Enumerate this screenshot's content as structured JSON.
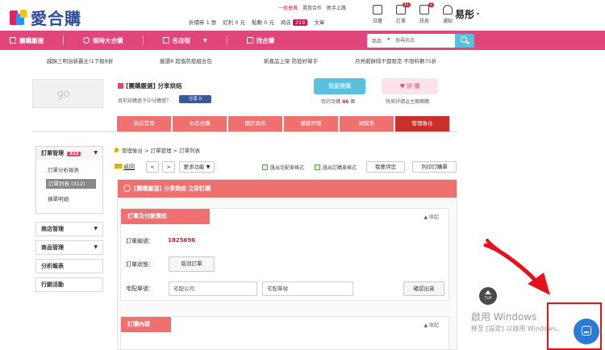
{
  "logo": {
    "text": "愛合購"
  },
  "member": {
    "level": "一般會員",
    "links": [
      "賣我合作",
      "新手上路"
    ]
  },
  "stats": {
    "discount": "折價券 1 張",
    "bonus": "紅利 0 元",
    "points": "點數 0 元",
    "store_label": "商店",
    "store_count": "219",
    "articles": "文章"
  },
  "icons": [
    {
      "name": "calendar-icon",
      "label": "日曆"
    },
    {
      "name": "order-icon",
      "label": "訂單",
      "badge": "31"
    },
    {
      "name": "message-icon",
      "label": "訊息",
      "badge": "2"
    },
    {
      "name": "bell-icon",
      "label": "通知"
    }
  ],
  "user_signature": "易彤",
  "nav": [
    "團購嚴選",
    "限時大合購",
    "名店街",
    "找合購"
  ],
  "search": {
    "category": "商品",
    "placeholder": "搜尋商品"
  },
  "promos": [
    "越酥三明治新霸主!1下殺8折",
    "嚴選8 超值防疫組合包",
    "新產品上架 防疫好幫手",
    "月亮蝦餅隔干都限定 不限料數75折"
  ],
  "store": {
    "logo_text": "go",
    "name": "[團購嚴選] 分享烘焙",
    "sub": "目前知購進于中分購撰？",
    "fb_label": "分享 0",
    "fav_label": "我要團購",
    "fav_sub_prefix": "我的合購",
    "fav_count": "46",
    "fav_sub_suffix": "團",
    "like_label": "♥ 評 價",
    "like_sub": "快來評價這主團團購"
  },
  "store_tabs": [
    "商店首頁",
    "本店合購",
    "關於商店",
    "顧客評價",
    "問與答",
    "管理後台"
  ],
  "sidebar": {
    "order_mgmt": "訂單管理",
    "order_count": "312",
    "items": [
      "訂單分析報表",
      "訂單列表 (312)",
      "揀單明細"
    ],
    "store_mgmt": "商店管理",
    "product_mgmt": "商品管理",
    "analysis": "分析報表",
    "marketing": "行銷活動"
  },
  "breadcrumb": "管理後台 > 訂單管理 > 訂單列表",
  "toolbar": {
    "back": "返回",
    "prev": "<",
    "next": ">",
    "more": "更多功能 ▼",
    "export_delivery": "匯出宅配單格式",
    "export_order": "匯出訂購單格式",
    "review_btn": "我要評您",
    "print_btn": "列印訂購單"
  },
  "order": {
    "title": "[團購嚴選] 分享烘焙 立即訂購",
    "section1": "訂單及付款資訊",
    "collapse": "▲ 收起",
    "no_label": "訂單編號：",
    "no_value": "1825696",
    "status_label": "訂單狀態：",
    "cancel_btn": "取消訂單",
    "delivery_label": "宅配單號：",
    "delivery_company_ph": "宅配公司",
    "delivery_no_ph": "宅配單號",
    "ship_btn": "確認出貨",
    "section2": "訂購內容"
  },
  "overlay": {
    "top_label": "TOP",
    "win_title": "啟用 Windows",
    "win_sub": "移至 [設定] 以啟用 Windows。"
  },
  "colors": {
    "brand": "#e0467a",
    "tab": "#f07070",
    "tab_active": "#c9302c",
    "fav": "#5bc0de",
    "alert": "#e5121b"
  }
}
